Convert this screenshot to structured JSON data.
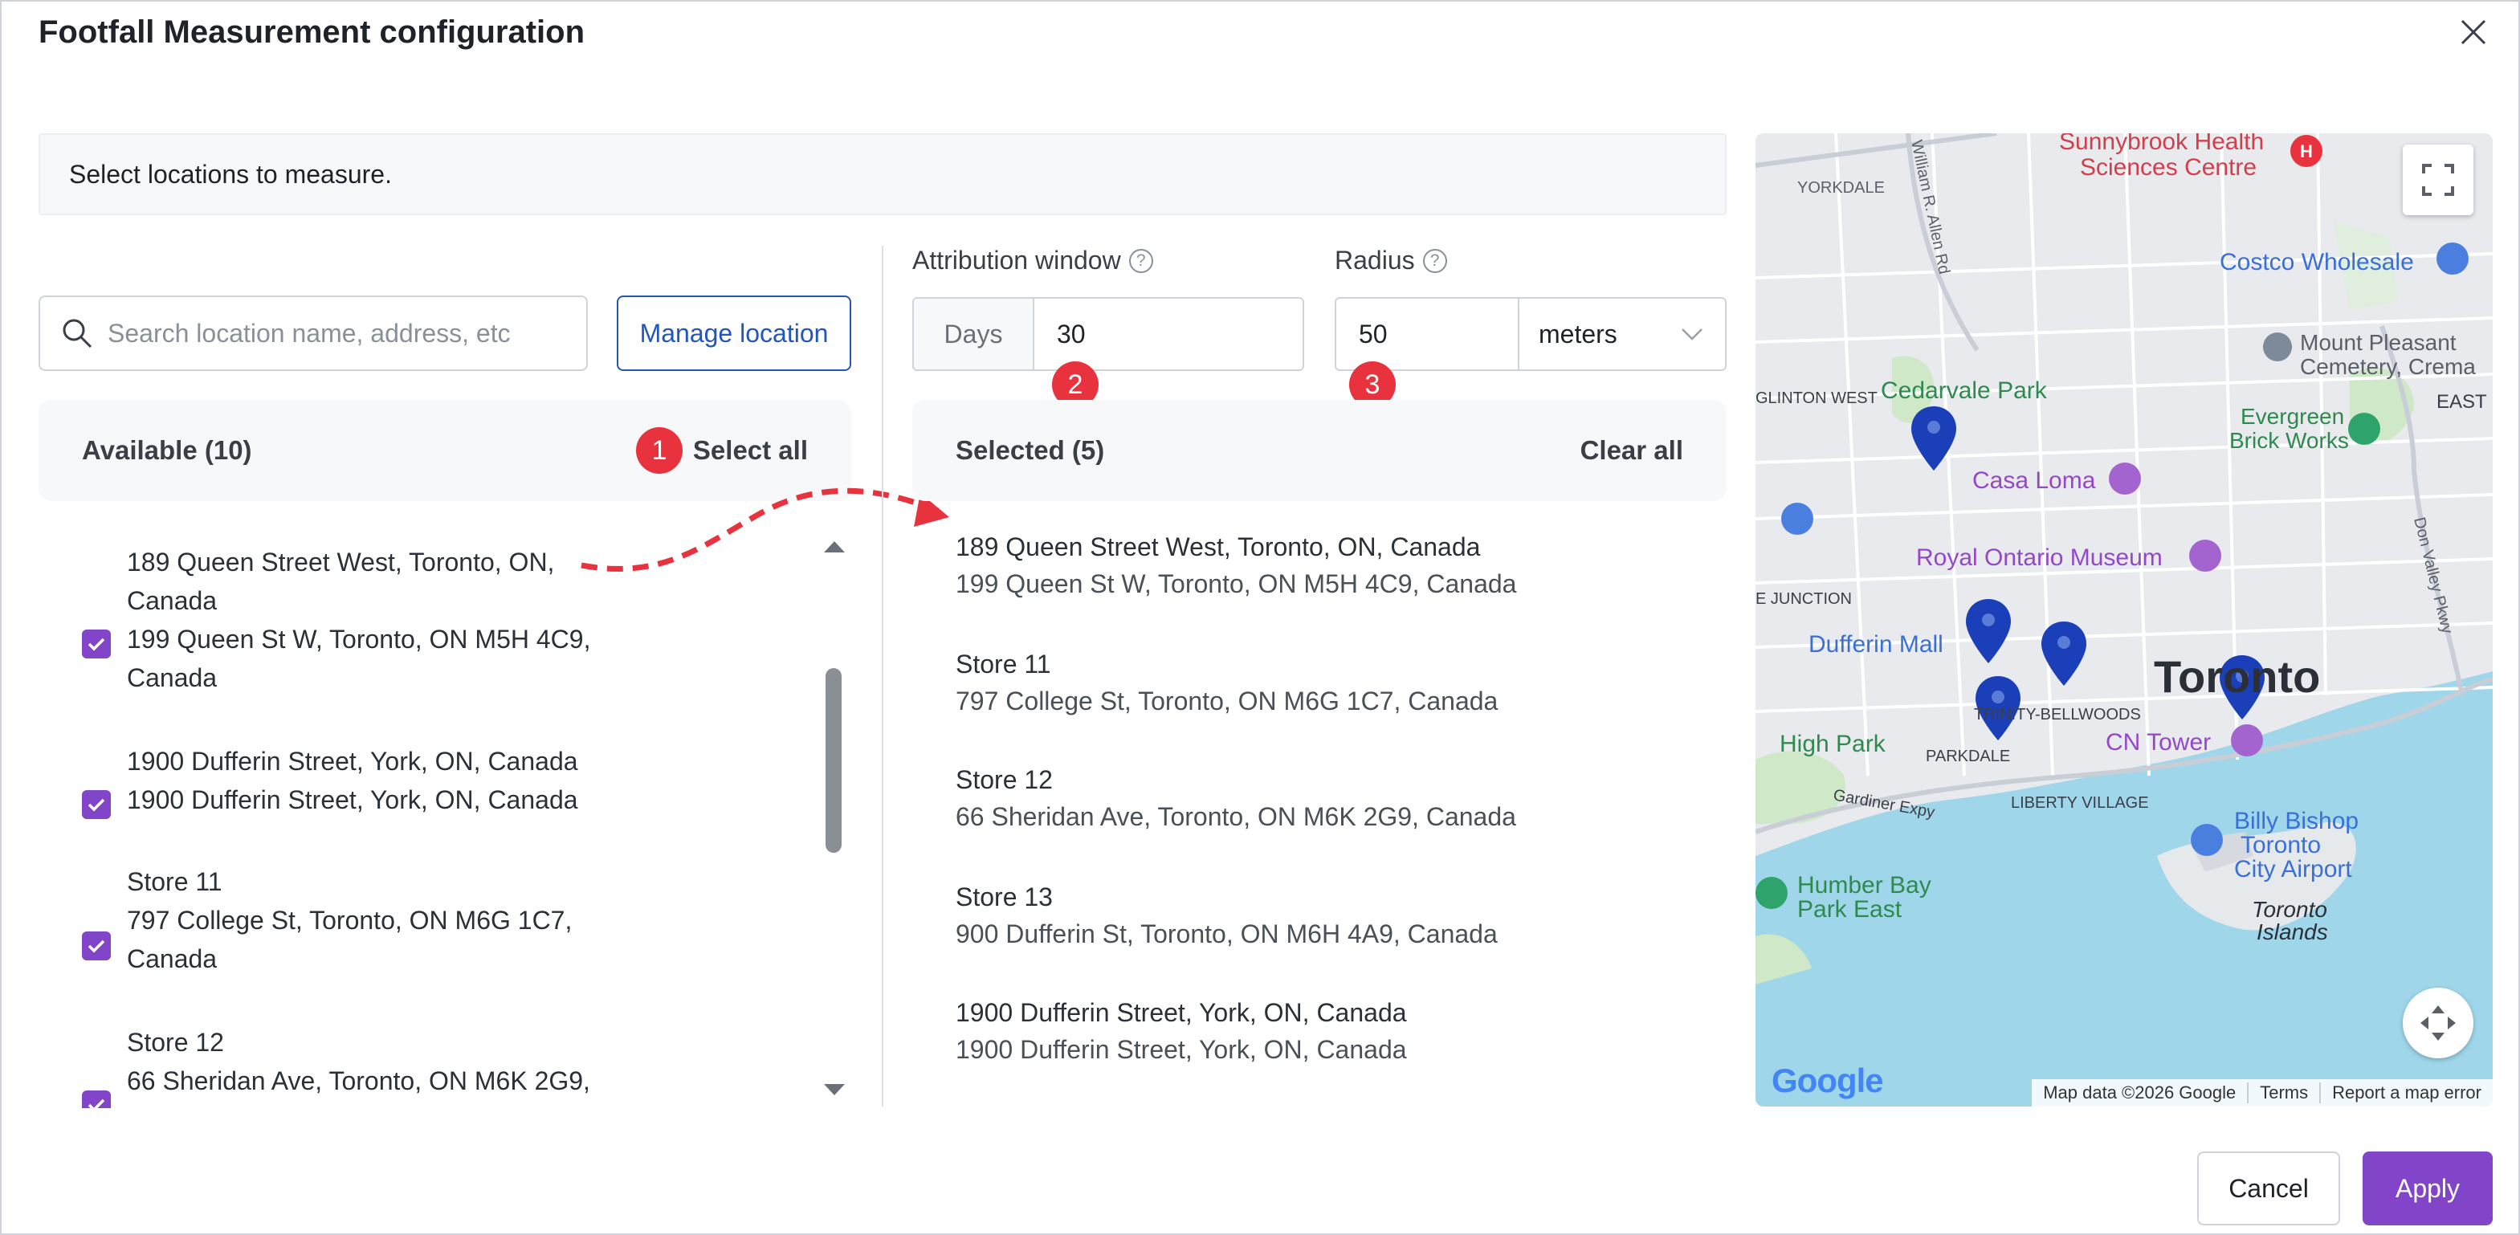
{
  "modal": {
    "title": "Footfall Measurement configuration",
    "instruction": "Select locations to measure."
  },
  "search": {
    "placeholder": "Search location name, address, etc"
  },
  "manage_location_label": "Manage location",
  "attribution_window": {
    "label": "Attribution window",
    "addon": "Days",
    "value": "30"
  },
  "radius": {
    "label": "Radius",
    "value": "50",
    "unit": "meters"
  },
  "available": {
    "header": "Available (10)",
    "select_all_label": "Select all",
    "items": [
      {
        "name": "189 Queen Street West, Toronto, ON, Canada",
        "address": "199 Queen St W, Toronto, ON M5H 4C9, Canada",
        "line1": "189 Queen Street West, Toronto, ON,",
        "line2": "Canada",
        "line3": "199 Queen St W, Toronto, ON M5H 4C9,",
        "line4": "Canada",
        "checked": true
      },
      {
        "name": "1900 Dufferin Street, York, ON, Canada",
        "address": "1900 Dufferin Street, York, ON, Canada",
        "checked": true
      },
      {
        "name": "Store 11",
        "address": "797 College St, Toronto, ON M6G 1C7, Canada",
        "line2": "797 College St, Toronto, ON M6G 1C7,",
        "line3": "Canada",
        "checked": true
      },
      {
        "name": "Store 12",
        "address": "66 Sheridan Ave, Toronto, ON M6K 2G9,",
        "checked": true
      }
    ]
  },
  "selected": {
    "header": "Selected (5)",
    "clear_all_label": "Clear all",
    "items": [
      {
        "name": "189 Queen Street West, Toronto, ON, Canada",
        "address": "199 Queen St W, Toronto, ON M5H 4C9, Canada"
      },
      {
        "name": "Store 11",
        "address": "797 College St, Toronto, ON M6G 1C7, Canada"
      },
      {
        "name": "Store 12",
        "address": "66 Sheridan Ave, Toronto, ON M6K 2G9, Canada"
      },
      {
        "name": "Store 13",
        "address": "900 Dufferin St, Toronto, ON M6H 4A9, Canada"
      },
      {
        "name": "1900 Dufferin Street, York, ON, Canada",
        "address": "1900 Dufferin Street, York, ON, Canada"
      }
    ]
  },
  "callouts": [
    "1",
    "2",
    "3"
  ],
  "map": {
    "labels": {
      "sunnybrook": "Sunnybrook Health",
      "sunnybrook2": "Sciences Centre",
      "yorkdale": "YORKDALE",
      "allen": "William R. Allen Rd",
      "costco": "Costco Wholesale",
      "mountpleasant": "Mount Pleasant",
      "mountpleasant2": "Cemetery, Crema",
      "eglinton": "GLINTON WEST",
      "cedarvale": "Cedarvale Park",
      "evergreen": "Evergreen",
      "evergreen2": "Brick Works",
      "east": "EAST",
      "casaloma": "Casa Loma",
      "donvalley": "Don Valley Pkwy",
      "rom": "Royal Ontario Museum",
      "junction": "E JUNCTION",
      "dufferinmall": "Dufferin Mall",
      "toronto": "Toronto",
      "trinity": "TRINITY-BELLWOODS",
      "highpark": "High Park",
      "parkdale": "PARKDALE",
      "cntower": "CN Tower",
      "gardiner": "Gardiner Expy",
      "liberty": "LIBERTY VILLAGE",
      "billybishop": "Billy Bishop",
      "billybishop2": "Toronto",
      "billybishop3": "City Airport",
      "humberbay": "Humber Bay",
      "humberbay2": "Park East",
      "islands": "Toronto",
      "islands2": "Islands"
    },
    "google_logo": "Google",
    "attribution": {
      "data": "Map data ©2026 Google",
      "terms": "Terms",
      "report": "Report a map error"
    }
  },
  "footer": {
    "cancel_label": "Cancel",
    "apply_label": "Apply"
  },
  "colors": {
    "accent": "#8245c9",
    "link": "#2456b8",
    "callout": "#e8323e"
  }
}
